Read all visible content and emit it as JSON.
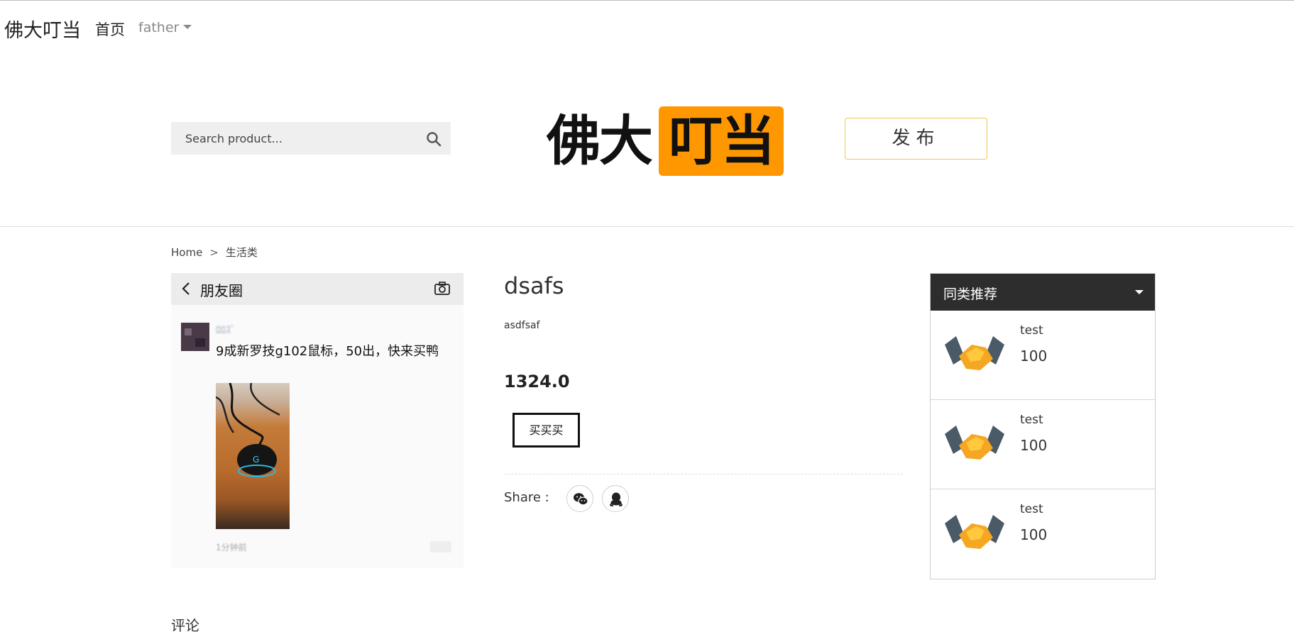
{
  "navbar": {
    "brand": "佛大叮当",
    "home_label": "首页",
    "user_label": "father"
  },
  "header": {
    "search_placeholder": "Search product...",
    "logo_text_left": "佛大",
    "logo_text_right": "叮当",
    "publish_label": "发布"
  },
  "breadcrumb": {
    "home": "Home",
    "separator": ">",
    "category": "生活类"
  },
  "post_image": {
    "topbar_title": "朋友圈",
    "nickname": "ﾛﾛｽﾞ",
    "text": "9成新罗技g102鼠标，50出，快来买鸭",
    "time": "1分钟前"
  },
  "product": {
    "title": "dsafs",
    "description": "asdfsaf",
    "price": "1324.0",
    "buy_label": "买买买",
    "share_label": "Share :",
    "share_icons": [
      "wechat-icon",
      "qq-icon"
    ]
  },
  "recommendations": {
    "title": "同类推荐",
    "items": [
      {
        "name": "test",
        "price": "100"
      },
      {
        "name": "test",
        "price": "100"
      },
      {
        "name": "test",
        "price": "100"
      }
    ]
  },
  "comments": {
    "heading": "评论"
  },
  "colors": {
    "accent": "#ff9800",
    "publish_border": "#f2c94c",
    "rec_header_bg": "#2d2d2d"
  }
}
